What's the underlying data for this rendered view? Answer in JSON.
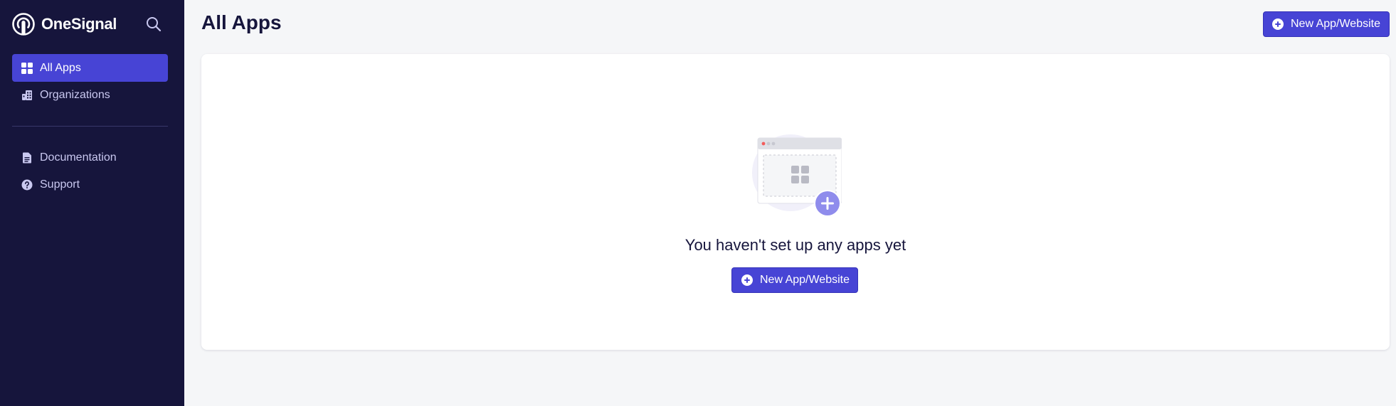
{
  "app": {
    "brand_name": "OneSignal"
  },
  "sidebar": {
    "search_icon": "search-icon",
    "items": [
      {
        "label": "All Apps",
        "icon": "grid-icon",
        "active": true
      },
      {
        "label": "Organizations",
        "icon": "building-icon",
        "active": false
      }
    ],
    "secondary_items": [
      {
        "label": "Documentation",
        "icon": "document-icon"
      },
      {
        "label": "Support",
        "icon": "help-icon"
      }
    ]
  },
  "header": {
    "title": "All Apps",
    "new_app_label": "New App/Website"
  },
  "main": {
    "empty_state_text": "You haven't set up any apps yet",
    "new_app_label": "New App/Website"
  },
  "colors": {
    "sidebar_bg": "#16153c",
    "accent": "#4744d5",
    "page_bg": "#f5f6f8"
  }
}
